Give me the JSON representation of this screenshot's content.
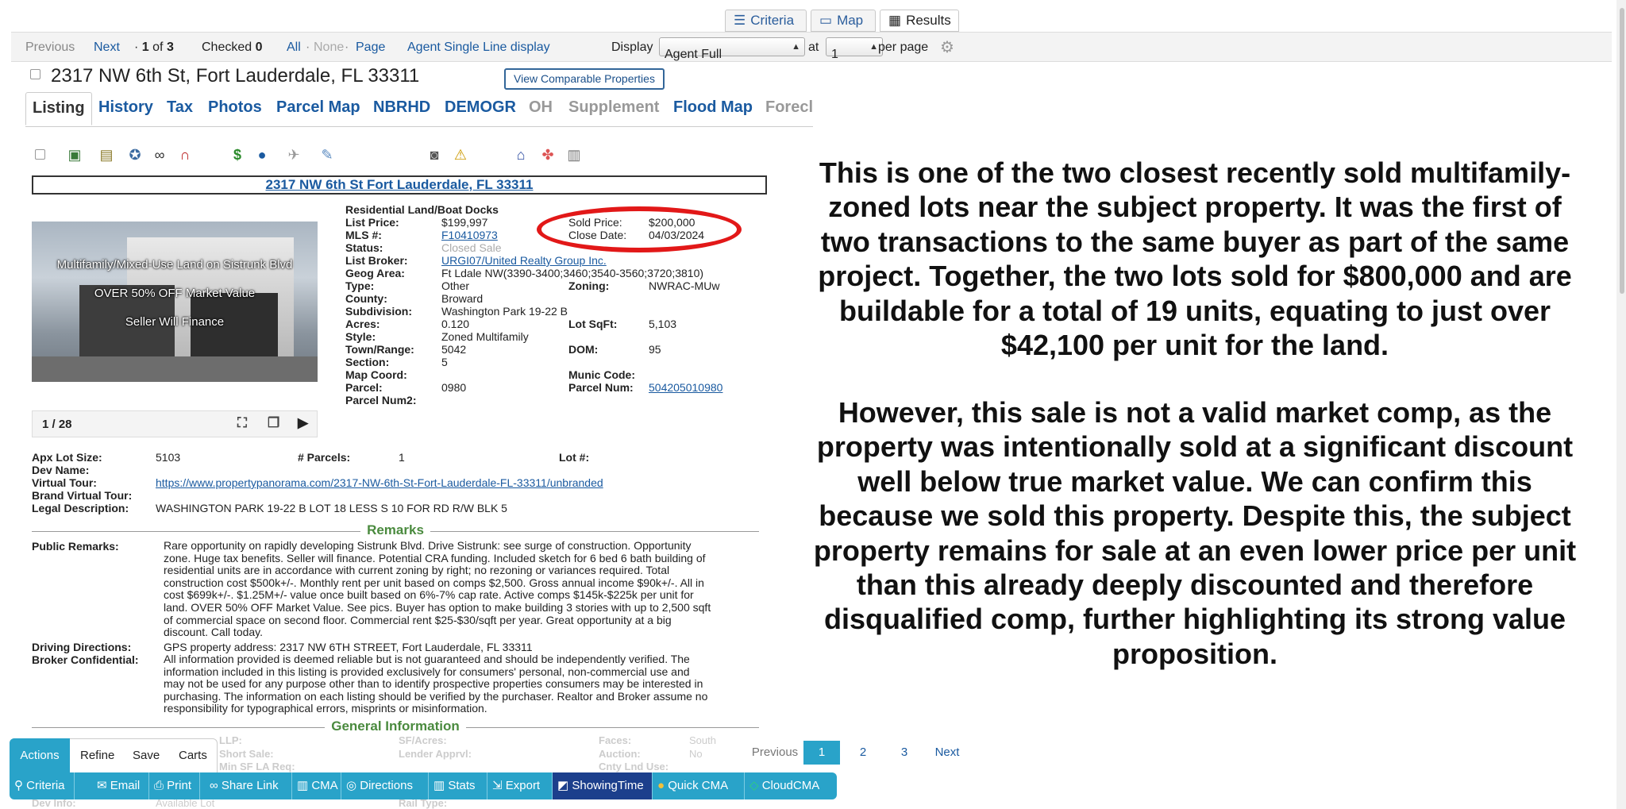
{
  "view_tabs": {
    "criteria": "Criteria",
    "map": "Map",
    "results": "Results"
  },
  "toolbar": {
    "previous": "Previous",
    "next": "Next",
    "pos_prefix": "·",
    "pos_current": "1",
    "pos_of": "of",
    "pos_total": "3",
    "checked_label": "Checked",
    "checked_count": "0",
    "all": "All",
    "sep": "·",
    "none": "None",
    "page": "Page",
    "agent_single": "Agent Single Line display",
    "display_label": "Display",
    "display_value": "Agent Full",
    "at_label": "at",
    "per_page_value": "1",
    "per_page_label": "per page"
  },
  "listing": {
    "title": "2317 NW 6th St, Fort Lauderdale, FL 33311",
    "comparable_button": "View Comparable Properties",
    "header_address": "2317 NW 6th St Fort Lauderdale, FL 33311"
  },
  "subtabs": [
    "Listing",
    "History",
    "Tax",
    "Photos",
    "Parcel Map",
    "NBRHD",
    "DEMOGR",
    "OH",
    "Supplement",
    "Flood Map",
    "Forecl"
  ],
  "icons": [
    "checkbox-icon",
    "photo-icon",
    "gallery-icon",
    "settings-icon",
    "link-icon",
    "magnet-icon",
    "dollar-icon",
    "globe-icon",
    "plane-icon",
    "tools-icon",
    "camera-icon",
    "warning-icon",
    "house-icon",
    "puzzle-icon",
    "document-icon"
  ],
  "photo": {
    "line1": "Multifamily/Mixed-Use Land on Sistrunk Blvd",
    "line2": "OVER 50% OFF Market Value",
    "line3": "Seller Will Finance",
    "counter": "1 / 28"
  },
  "details": {
    "type_heading": "Residential Land/Boat Docks",
    "list_price_label": "List Price:",
    "list_price": "$199,997",
    "sold_price_label": "Sold Price:",
    "sold_price": "$200,000",
    "mls_label": "MLS #:",
    "mls": "F10410973",
    "close_date_label": "Close Date:",
    "close_date": "04/03/2024",
    "status_label": "Status:",
    "status": "Closed Sale",
    "list_broker_label": "List Broker:",
    "list_broker": "URGI07/United Realty Group Inc.",
    "geog_label": "Geog Area:",
    "geog": "Ft Ldale NW(3390-3400;3460;3540-3560;3720;3810)",
    "type_label": "Type:",
    "type": "Other",
    "zoning_label": "Zoning:",
    "zoning": "NWRAC-MUw",
    "county_label": "County:",
    "county": "Broward",
    "subdivision_label": "Subdivision:",
    "subdivision": "Washington Park 19-22 B",
    "acres_label": "Acres:",
    "acres": "0.120",
    "lot_sqft_label": "Lot SqFt:",
    "lot_sqft": "5,103",
    "style_label": "Style:",
    "style": "Zoned Multifamily",
    "town_range_label": "Town/Range:",
    "town_range": "5042",
    "dom_label": "DOM:",
    "dom": "95",
    "section_label": "Section:",
    "section": "5",
    "map_coord_label": "Map Coord:",
    "munic_code_label": "Munic Code:",
    "parcel_label": "Parcel:",
    "parcel": "0980",
    "parcel_num_label": "Parcel Num:",
    "parcel_num": "504205010980",
    "parcel_num2_label": "Parcel Num2:",
    "apx_lot_label": "Apx Lot Size:",
    "apx_lot": "5103",
    "parcels_label": "# Parcels:",
    "parcels": "1",
    "lot_num_label": "Lot #:",
    "dev_name_label": "Dev Name:",
    "virtual_tour_label": "Virtual Tour:",
    "virtual_tour": "https://www.propertypanorama.com/2317-NW-6th-St-Fort-Lauderdale-FL-33311/unbranded",
    "brand_tour_label": "Brand Virtual Tour:",
    "legal_label": "Legal Description:",
    "legal": "WASHINGTON PARK 19-22 B LOT 18 LESS S 10 FOR RD R/W BLK 5"
  },
  "remarks": {
    "heading": "Remarks",
    "public_label": "Public Remarks:",
    "public_lines": [
      "Rare opportunity on rapidly developing Sistrunk Blvd. Drive Sistrunk: see surge of construction. Opportunity",
      "zone. Huge tax benefits. Seller will finance. Potential CRA funding. Included sketch for 6 bed 6 bath building of",
      "residential units are in accordance with current zoning by right; no rezoning or variances required. Total",
      "construction cost $500k+/-. Monthly rent per unit based on comps $2,500. Gross annual income $90k+/-. All in",
      "cost $699k+/-. $1.25M+/- value once built based on 6%-7% cap rate. Active comps $145k-$225k per unit for",
      "land. OVER 50% OFF Market Value. See pics. Buyer has option to make building 3 stories with up to 2,500 sqft",
      "of commercial space on second floor. Commercial rent $25-$30/sqft per year. Great opportunity at a big",
      "discount. Call today."
    ],
    "driving_label": "Driving Directions:",
    "driving": "GPS property address: 2317 NW 6TH STREET, Fort Lauderdale, FL 33311",
    "broker_label": "Broker Confidential:",
    "broker_lines": [
      "All information provided is deemed reliable but is not guaranteed and should be independently verified. The",
      "information included in this listing is provided exclusively for consumers' personal, non-commercial use and",
      "may not be used for any purpose other than to identify prospective properties consumers may be interested in",
      "purchasing. The information on each listing should be verified by the purchaser. Realtor and Broker assume no",
      "responsibility for typographical errors, misprints or misinformation."
    ],
    "general_heading": "General Information"
  },
  "callout": {
    "para1": [
      "This is one of the two closest recently sold multifamily-",
      "zoned lots near the subject property. It was the first of",
      "two transactions to the same buyer as part of the same",
      "project. Together, the two lots sold for $800,000 and are",
      "buildable for a total of 19 units, equating to just over",
      "$42,100 per unit for the land."
    ],
    "para2": [
      "However, this sale is not a valid market comp, as the",
      "property was intentionally sold at a significant discount",
      "well below true market value. We can confirm this",
      "because we sold this property. Despite this, the subject",
      "property remains for sale at an even lower price per unit",
      "than this already deeply discounted and therefore",
      "disqualified comp, further highlighting its strong value",
      "proposition."
    ]
  },
  "bottom_tabs": {
    "actions": "Actions",
    "refine": "Refine",
    "save": "Save",
    "carts": "Carts"
  },
  "action_buttons": [
    "Criteria",
    "Email",
    "Print",
    "Share Link",
    "CMA",
    "Directions",
    "Stats",
    "Export",
    "ShowingTime",
    "Quick CMA",
    "CloudCMA"
  ],
  "pagination": {
    "previous": "Previous",
    "pages": [
      "1",
      "2",
      "3"
    ],
    "next": "Next"
  }
}
